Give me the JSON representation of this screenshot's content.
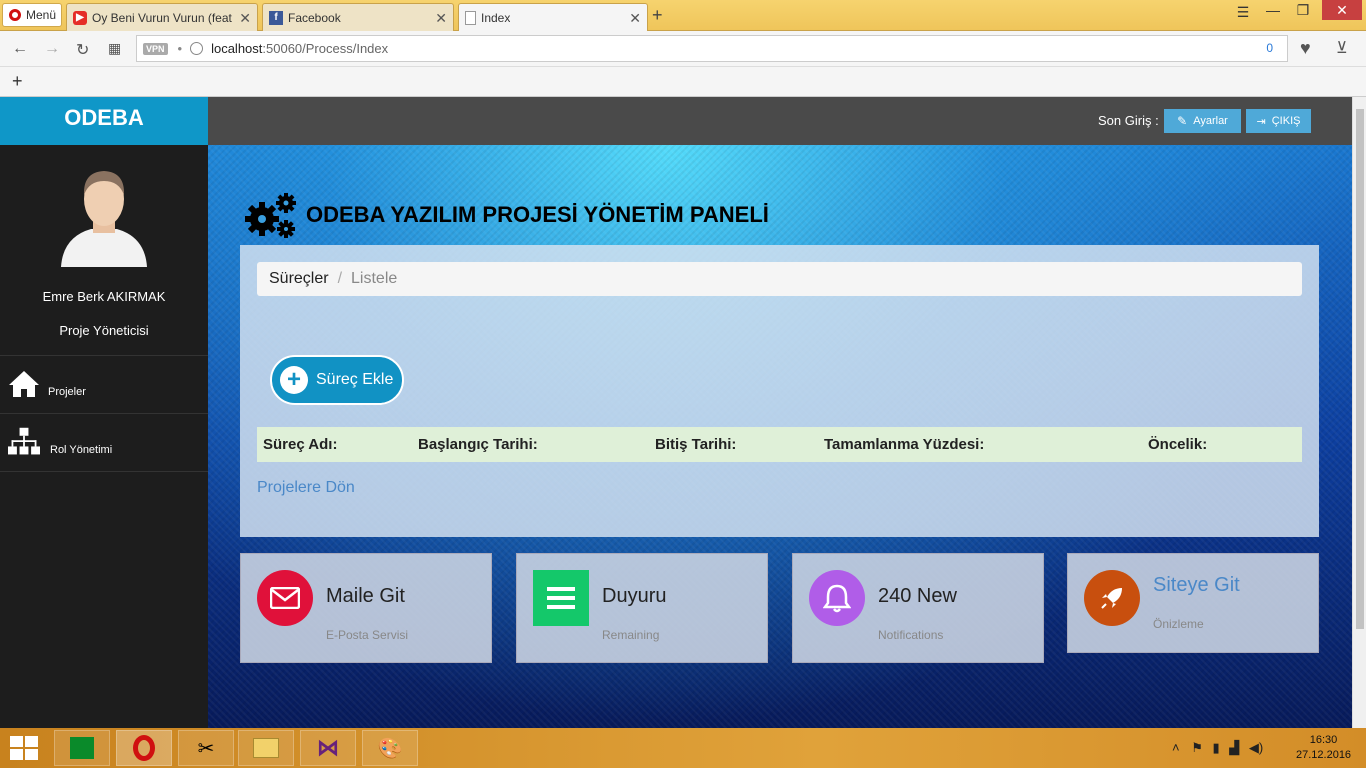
{
  "browser": {
    "menu_label": "Menü",
    "tabs": [
      {
        "title": "Oy Beni Vurun Vurun (feat",
        "icon": "youtube-icon"
      },
      {
        "title": "Facebook",
        "icon": "facebook-icon"
      },
      {
        "title": "Index",
        "icon": "page-icon"
      }
    ],
    "vpn_label": "VPN",
    "url_host": "localhost",
    "url_path": ":50060/Process/Index",
    "adblock_count": "0"
  },
  "app": {
    "brand": "ODEBA",
    "user": {
      "name": "Emre Berk AKIRMAK",
      "role": "Proje Yöneticisi"
    },
    "menu": [
      {
        "label": "Projeler",
        "icon": "home-icon"
      },
      {
        "label": "Rol Yönetimi",
        "icon": "sitemap-icon"
      }
    ],
    "topbar": {
      "last_login": "Son Giriş :",
      "settings": "Ayarlar",
      "logout": "ÇIKIŞ"
    },
    "panel_title": "ODEBA YAZILIM PROJESİ YÖNETİM PANELİ",
    "breadcrumb": {
      "current": "Süreçler",
      "separator": "/",
      "last": "Listele"
    },
    "add_button": "Süreç Ekle",
    "table_headers": [
      "Süreç Adı:",
      "Başlangıç Tarihi:",
      "Bitiş Tarihi:",
      "Tamamlanma Yüzdesi:",
      "Öncelik:"
    ],
    "back_link": "Projelere Dön",
    "cards": [
      {
        "title": "Maile Git",
        "subtitle": "E-Posta Servisi",
        "icon": "envelope-icon",
        "color": "#e0113a"
      },
      {
        "title": "Duyuru",
        "subtitle": "Remaining",
        "icon": "list-icon",
        "color": "#14c86a"
      },
      {
        "title": "240 New",
        "subtitle": "Notifications",
        "icon": "bell-icon",
        "color": "#b05de8"
      },
      {
        "title": "Siteye Git",
        "subtitle": "Önizleme",
        "icon": "rocket-icon",
        "color": "#c84f0e"
      }
    ]
  },
  "taskbar": {
    "time": "16:30",
    "date": "27.12.2016"
  }
}
